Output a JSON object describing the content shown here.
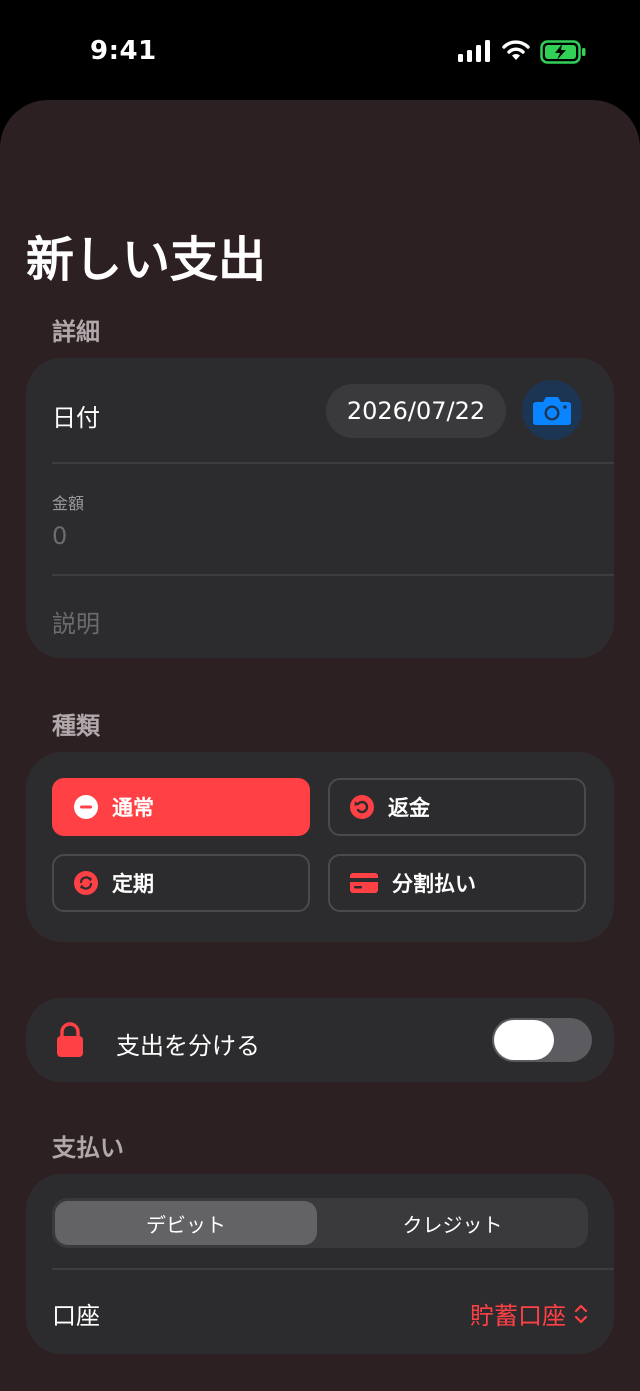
{
  "status": {
    "time": "9:41"
  },
  "title": "新しい支出",
  "details": {
    "section_title": "詳細",
    "date_label": "日付",
    "date_value": "2026/07/22",
    "amount_label": "金額",
    "amount_placeholder": "0",
    "description_placeholder": "説明"
  },
  "type": {
    "section_title": "種類",
    "options": [
      {
        "label": "通常",
        "icon": "minus-circle-icon",
        "selected": true
      },
      {
        "label": "返金",
        "icon": "refund-icon",
        "selected": false
      },
      {
        "label": "定期",
        "icon": "recurring-icon",
        "selected": false
      },
      {
        "label": "分割払い",
        "icon": "card-icon",
        "selected": false
      }
    ]
  },
  "split": {
    "label": "支出を分ける",
    "icon": "lock-icon",
    "enabled": false
  },
  "payment": {
    "section_title": "支払い",
    "segments": [
      "デビット",
      "クレジット"
    ],
    "selected_segment": "デビット",
    "account_label": "口座",
    "account_value": "貯蓄口座"
  },
  "colors": {
    "accent": "#ff4045",
    "sheet_bg": "#2d2022",
    "card_bg": "#2c2c2e",
    "camera": "#0a84ff"
  }
}
